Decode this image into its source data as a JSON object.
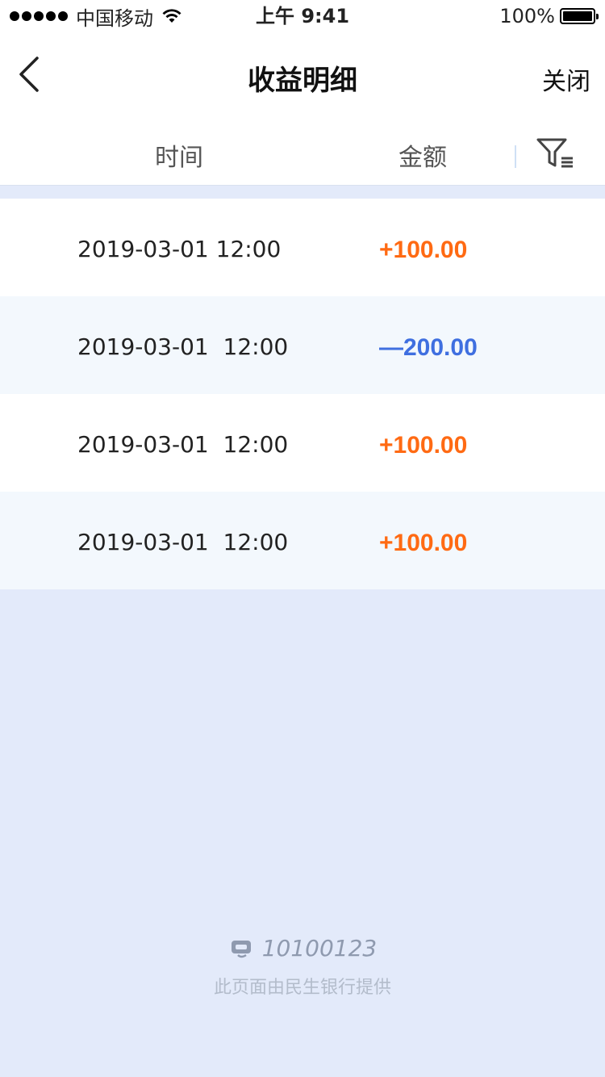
{
  "status_bar": {
    "carrier": "中国移动",
    "time": "上午 9:41",
    "battery": "100%"
  },
  "nav": {
    "title": "收益明细",
    "close_label": "关闭"
  },
  "table": {
    "columns": [
      "时间",
      "金额"
    ],
    "rows": [
      {
        "time": "2019-03-01 12:00",
        "amount": "+100.00",
        "type": "pos"
      },
      {
        "time": "2019-03-01  12:00",
        "amount": "—200.00",
        "type": "neg"
      },
      {
        "time": "2019-03-01  12:00",
        "amount": "+100.00",
        "type": "pos"
      },
      {
        "time": "2019-03-01  12:00",
        "amount": "+100.00",
        "type": "pos"
      }
    ]
  },
  "footer": {
    "hotline": "10100123",
    "provider": "此页面由民生银行提供"
  },
  "colors": {
    "positive": "#ff6a13",
    "negative": "#3f6fe0",
    "background": "#e3eafa"
  },
  "icons": {
    "back": "chevron-left-icon",
    "filter": "filter-list-icon",
    "hotline": "customer-service-icon"
  }
}
